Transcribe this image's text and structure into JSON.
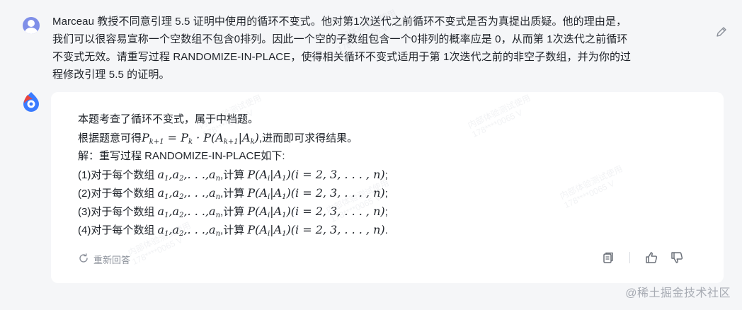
{
  "question": {
    "text_l1": "Marceau 教授不同意引理 5.5 证明中使用的循环不变式。他对第1次送代之前循环不变式是否为真提出质疑。他的理由是，",
    "text_l2": "我们可以很容易宣称一个空数组不包含0排列。因此一个空的子数组包含一个0排列的概率应是 0，从而第 1次迭代之前循环",
    "text_l3": "不变式无效。请重写过程 RANDOMIZE-IN-PLACE，使得相关循环不变式适用于第 1次迭代之前的非空子数组，并为你的过",
    "text_l4": "程修改引理 5.5 的证明。"
  },
  "answer": {
    "line1": "本题考查了循环不变式，属于中档题。",
    "line2_prefix": "根据题意可得",
    "line2_suffix": ",进而即可求得结果。",
    "line3": "解：重写过程 RANDOMIZE-IN-PLACE如下:",
    "items": [
      {
        "prefix": "(1)对于每个数组 ",
        "mid": ",计算 ",
        "end": ";"
      },
      {
        "prefix": "(2)对于每个数组 ",
        "mid": ",计算 ",
        "end": ";"
      },
      {
        "prefix": "(3)对于每个数组 ",
        "mid": ",计算 ",
        "end": ";"
      },
      {
        "prefix": "(4)对于每个数组 ",
        "mid": ",计算 ",
        "end": "."
      }
    ]
  },
  "regenerate_label": "重新回答",
  "footer_watermark": "@稀土掘金技术社区",
  "watermark": {
    "line1": "内部体验测试使用",
    "line2": "178****0065 V"
  },
  "icons": {
    "edit": "pencil-icon",
    "regenerate": "refresh-icon",
    "copy": "copy-icon",
    "like": "thumbs-up-icon",
    "dislike": "thumbs-down-icon"
  },
  "colors": {
    "page_bg": "#f5f6f8",
    "card_bg": "#ffffff",
    "muted": "#8a8f99",
    "avatar": "#7f8fe8",
    "brand_red": "#e9443e",
    "brand_blue": "#3a7bff"
  }
}
